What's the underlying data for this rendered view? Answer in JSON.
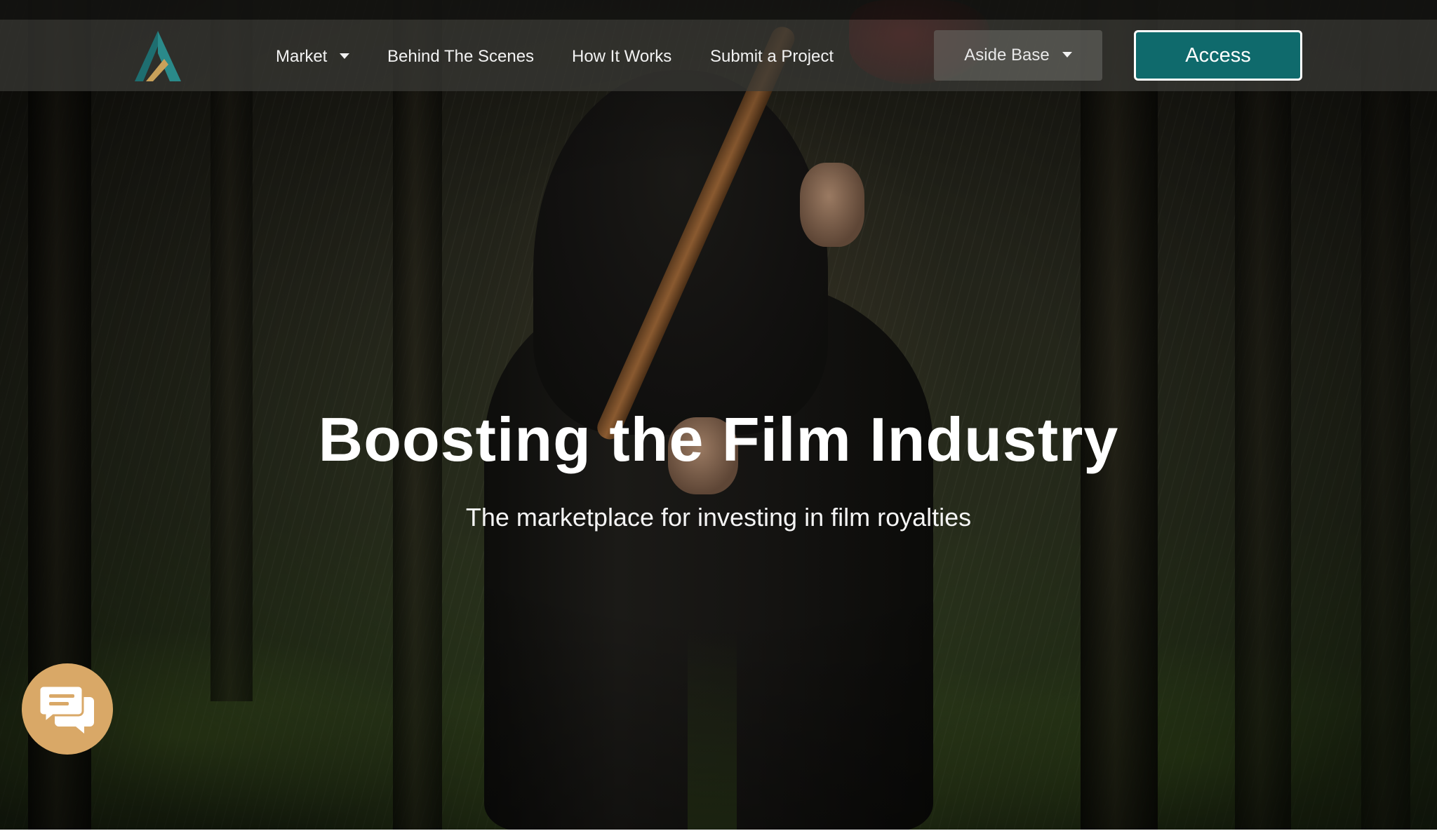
{
  "header": {
    "logo_icon": "triangle-a-logo-icon",
    "nav": [
      {
        "label": "Market",
        "has_dropdown": true
      },
      {
        "label": "Behind The Scenes",
        "has_dropdown": false
      },
      {
        "label": "How It Works",
        "has_dropdown": false
      },
      {
        "label": "Submit a Project",
        "has_dropdown": false
      }
    ],
    "aside_base": {
      "label": "Aside Base",
      "has_dropdown": true
    },
    "access_button": {
      "label": "Access"
    }
  },
  "hero": {
    "title": "Boosting the Film Industry",
    "subtitle": "The marketplace for investing in film royalties"
  },
  "chat_widget": {
    "icon": "chat-bubbles-icon"
  },
  "colors": {
    "accent_teal": "#0f6a6c",
    "chat_gold": "#d9a867",
    "logo_teal": "#2a8a8a",
    "logo_gold": "#c9a15a"
  }
}
